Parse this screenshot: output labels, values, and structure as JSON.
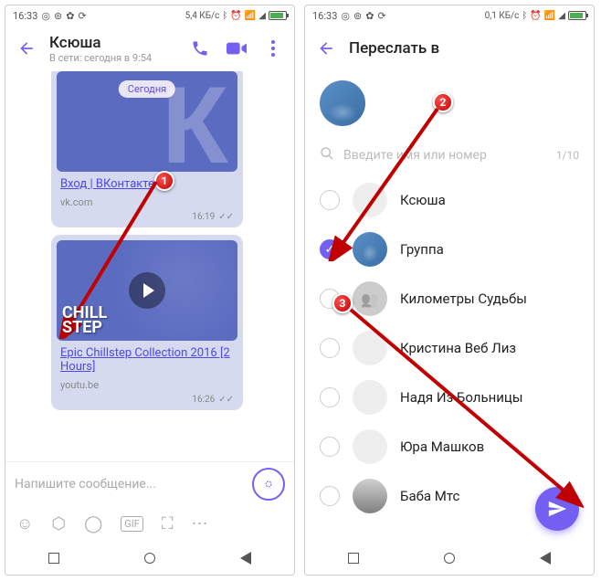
{
  "statusbar": {
    "time": "16:33",
    "data_left": "5,4 КБ/с",
    "data_right": "0,1 КБ/с"
  },
  "chat": {
    "title": "Ксюша",
    "subtitle": "В сети: сегодня в 9:54",
    "day_label": "Сегодня",
    "msg1": {
      "link_text": "Вход | ВКонтакте",
      "host": "vk.com",
      "time": "16:19"
    },
    "msg2": {
      "overlay_line1": "CHILL",
      "overlay_line2": "STEP",
      "link_text": "Epic Chillstep Collection 2016 [2 Hours]",
      "host": "youtu.be",
      "time": "16:26"
    },
    "input_placeholder": "Напишите сообщение..."
  },
  "forward": {
    "title": "Переслать в",
    "search_placeholder": "Введите имя или номер",
    "counter": "1/10",
    "contacts": [
      {
        "name": "Ксюша",
        "checked": false,
        "avatar": "blank"
      },
      {
        "name": "Группа",
        "checked": true,
        "avatar": "car"
      },
      {
        "name": "Километры Судьбы",
        "checked": false,
        "avatar": "group"
      },
      {
        "name": "Кристина Веб Лиз",
        "checked": false,
        "avatar": "blank"
      },
      {
        "name": "Надя Из Больницы",
        "checked": false,
        "avatar": "blank"
      },
      {
        "name": "Юра Машков",
        "checked": false,
        "avatar": "blank"
      },
      {
        "name": "Баба Мтс",
        "checked": false,
        "avatar": "photo"
      }
    ]
  },
  "annotations": {
    "badge1": "1",
    "badge2": "2",
    "badge3": "3"
  }
}
